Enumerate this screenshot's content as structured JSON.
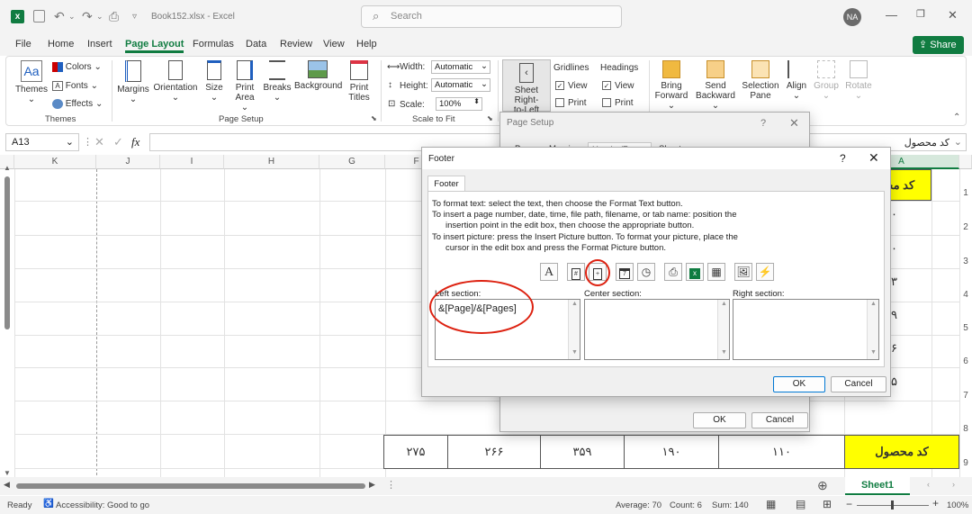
{
  "titlebar": {
    "filename": "Book152.xlsx",
    "app": "Excel",
    "search_placeholder": "Search",
    "avatar": "NA"
  },
  "menu": {
    "tabs": [
      "File",
      "Home",
      "Insert",
      "Page Layout",
      "Formulas",
      "Data",
      "Review",
      "View",
      "Help"
    ],
    "active": "Page Layout",
    "share_label": "Share"
  },
  "ribbon": {
    "themes": "Themes",
    "colors": "Colors",
    "fonts": "Fonts",
    "effects": "Effects",
    "themes_group": "Themes",
    "margins": "Margins",
    "orientation": "Orientation",
    "size": "Size",
    "print_area_1": "Print",
    "print_area_2": "Area",
    "breaks": "Breaks",
    "background": "Background",
    "print_titles_1": "Print",
    "print_titles_2": "Titles",
    "page_setup_group": "Page Setup",
    "width_label": "Width:",
    "width_value": "Automatic",
    "height_label": "Height:",
    "height_value": "Automatic",
    "scale_label": "Scale:",
    "scale_value": "100%",
    "scale_group": "Scale to Fit",
    "sheet_rtl_1": "Sheet Right-",
    "sheet_rtl_2": "to-Left",
    "gridlines": "Gridlines",
    "headings": "Headings",
    "view": "View",
    "print": "Print",
    "bring_forward_1": "Bring",
    "bring_forward_2": "Forward",
    "send_backward_1": "Send",
    "send_backward_2": "Backward",
    "selection_pane_1": "Selection",
    "selection_pane_2": "Pane",
    "align": "Align",
    "group": "Group",
    "rotate": "Rotate"
  },
  "formula": {
    "namebox": "A13",
    "fx": "fx",
    "cell_value": "کد محصول"
  },
  "grid": {
    "columns": [
      "K",
      "J",
      "I",
      "H",
      "G",
      "F",
      "A"
    ],
    "row_numbers": [
      "1",
      "2",
      "3",
      "4",
      "5",
      "6",
      "7",
      "8",
      "9"
    ],
    "colA_values": [
      "کد محصول",
      "۱۱۰",
      "۱۹۰",
      "۲۲۳",
      "۳۵۹",
      "۲۶۶",
      "۲۷۵"
    ],
    "bottom_row": [
      "۲۷۵",
      "۲۶۶",
      "۳۵۹",
      "۱۹۰",
      "۱۱۰",
      "کد محصول"
    ]
  },
  "page_setup": {
    "title": "Page Setup",
    "help": "?",
    "tabs": [
      "Page",
      "Margins",
      "Header/Footer",
      "Sheet"
    ],
    "ok": "OK",
    "cancel": "Cancel"
  },
  "footer_dialog": {
    "title": "Footer",
    "help": "?",
    "tab": "Footer",
    "line1": "To format text:  select the text, then choose the Format Text button.",
    "line2": "To insert a page number, date, time, file path, filename, or tab name:  position the",
    "line3": "insertion point in the edit box, then choose the appropriate button.",
    "line4": "To insert picture: press the Insert Picture button.  To format your picture, place the",
    "line5": "cursor in the edit box and press the Format Picture button.",
    "left_label": "Left section:",
    "center_label": "Center section:",
    "right_label": "Right section:",
    "left_value": "&[Page]/&[Pages]",
    "ok": "OK",
    "cancel": "Cancel"
  },
  "sheets": {
    "active": "Sheet1"
  },
  "status": {
    "ready": "Ready",
    "accessibility": "Accessibility: Good to go",
    "average": "Average: 70",
    "count": "Count: 6",
    "sum": "Sum: 140",
    "zoom": "100%"
  },
  "colors": {
    "excel_green": "#107c41",
    "highlight_yellow": "#ffff00",
    "annotation_red": "#dd1111"
  }
}
